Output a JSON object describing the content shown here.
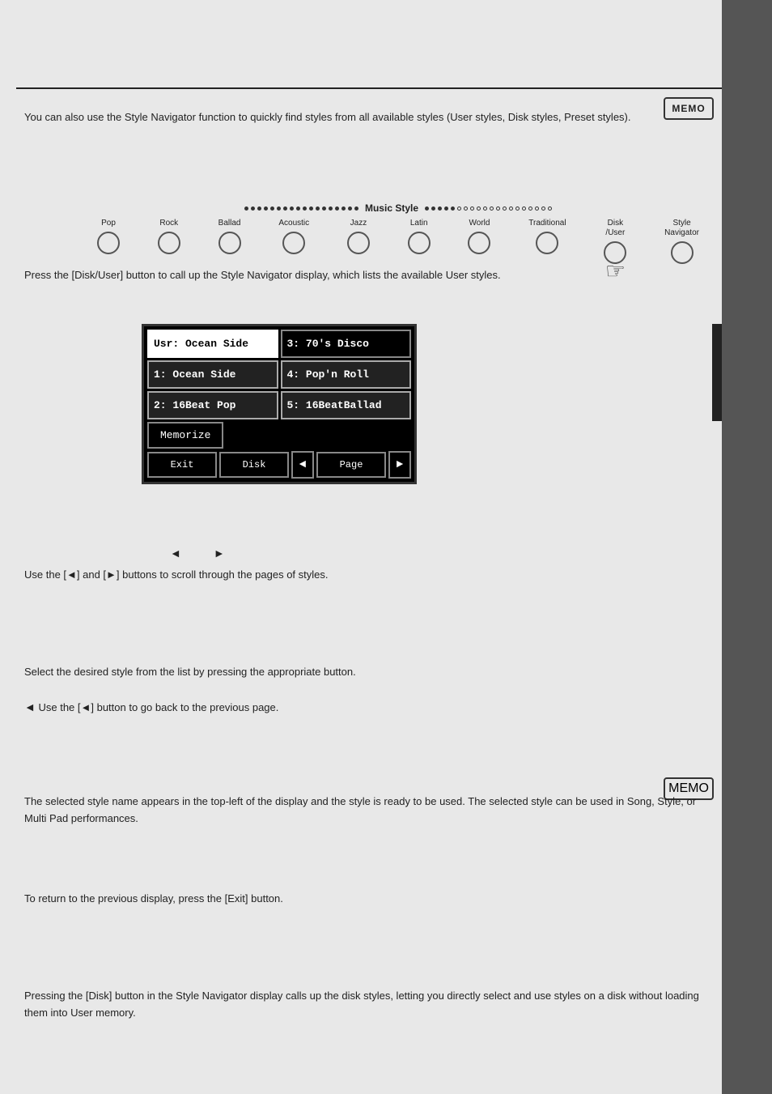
{
  "memo_top": {
    "label": "MEMO"
  },
  "memo_bottom": {
    "label": "MEMO"
  },
  "music_style": {
    "label": "Music Style",
    "buttons": [
      {
        "id": "pop",
        "label": "Pop"
      },
      {
        "id": "rock",
        "label": "Rock"
      },
      {
        "id": "ballad",
        "label": "Ballad"
      },
      {
        "id": "acoustic",
        "label": "Acoustic"
      },
      {
        "id": "jazz",
        "label": "Jazz"
      },
      {
        "id": "latin",
        "label": "Latin"
      },
      {
        "id": "world",
        "label": "World"
      },
      {
        "id": "traditional",
        "label": "Traditional"
      },
      {
        "id": "disk-user",
        "label": "Disk\n/User"
      },
      {
        "id": "style-navigator",
        "label": "Style\nNavigator"
      }
    ]
  },
  "display": {
    "items": [
      {
        "id": "usr-ocean-side",
        "label": "Usr: Ocean Side",
        "col": 0,
        "selected": true
      },
      {
        "id": "item-3",
        "label": "3: 70's Disco",
        "col": 1,
        "selected": false
      },
      {
        "id": "item-1",
        "label": "1: Ocean Side",
        "col": 0,
        "selected": false
      },
      {
        "id": "item-4",
        "label": "4: Pop'n Roll",
        "col": 1,
        "selected": false
      },
      {
        "id": "item-2",
        "label": "2: 16Beat Pop",
        "col": 0,
        "selected": false
      },
      {
        "id": "item-5",
        "label": "5: 16BeatBallad",
        "col": 1,
        "selected": false
      }
    ],
    "memorize_label": "Memorize",
    "exit_label": "Exit",
    "disk_label": "Disk",
    "page_label": "Page",
    "arrow_left": "◄",
    "arrow_right": "►"
  },
  "body_text": {
    "para_1": "You can also use the Style Navigator function to quickly find styles from all available styles (User styles, Disk styles, Preset styles).",
    "para_2": "Press the [Disk/User] button to call up the Style Navigator display, which lists the available User styles.",
    "para_3": "Use the [◄] and [►] buttons to scroll through the pages of styles.",
    "para_4": "Select the desired style from the list by pressing the appropriate button.",
    "para_4b": "Use the [◄] button to go back to the previous page.",
    "para_5": "The selected style name appears in the top-left of the display and the style is ready to be used. The selected style can be used in Song, Style, or Multi Pad performances.",
    "para_6": "To return to the previous display, press the [Exit] button.",
    "para_7": "Pressing the [Disk] button in the Style Navigator display calls up the disk styles, letting you directly select and use styles on a disk without loading them into User memory."
  }
}
